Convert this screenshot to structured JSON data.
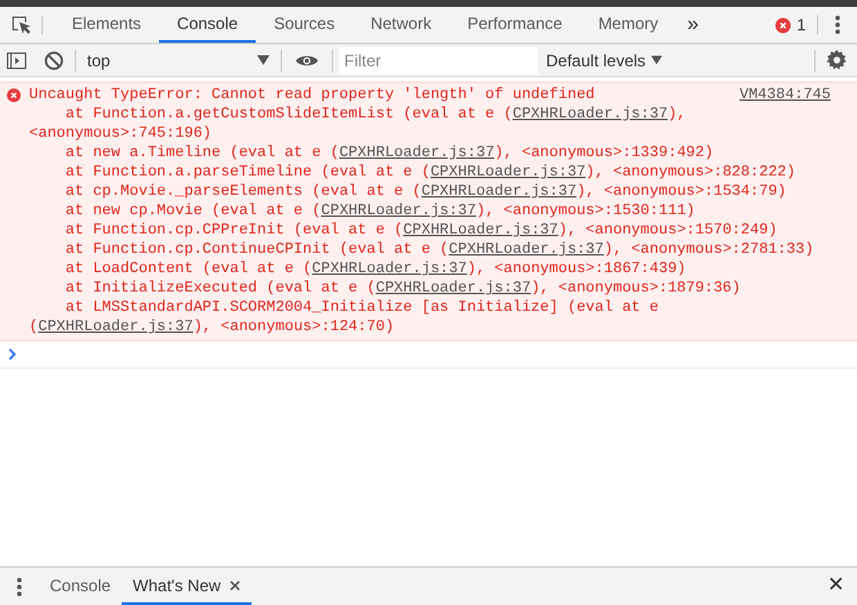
{
  "tabs": [
    {
      "label": "Elements",
      "selected": false
    },
    {
      "label": "Console",
      "selected": true
    },
    {
      "label": "Sources",
      "selected": false
    },
    {
      "label": "Network",
      "selected": false
    },
    {
      "label": "Performance",
      "selected": false
    },
    {
      "label": "Memory",
      "selected": false
    }
  ],
  "overflow": "»",
  "error_count": "1",
  "toolbar": {
    "context": "top",
    "filter_placeholder": "Filter",
    "levels": "Default levels"
  },
  "messages": [
    {
      "kind": "error",
      "text": "Uncaught TypeError: Cannot read property 'length' of undefined",
      "source": "VM4384:745",
      "stack": [
        {
          "prefix": "    at Function.a.getCustomSlideItemList (eval at e (",
          "link": "CPXHRLoader.js:37",
          "suffix": "), <anonymous>:745:196)"
        },
        {
          "prefix": "    at new a.Timeline (eval at e (",
          "link": "CPXHRLoader.js:37",
          "suffix": "), <anonymous>:1339:492)"
        },
        {
          "prefix": "    at Function.a.parseTimeline (eval at e (",
          "link": "CPXHRLoader.js:37",
          "suffix": "), <anonymous>:828:222)"
        },
        {
          "prefix": "    at cp.Movie._parseElements (eval at e (",
          "link": "CPXHRLoader.js:37",
          "suffix": "), <anonymous>:1534:79)"
        },
        {
          "prefix": "    at new cp.Movie (eval at e (",
          "link": "CPXHRLoader.js:37",
          "suffix": "), <anonymous>:1530:111)"
        },
        {
          "prefix": "    at Function.cp.CPPreInit (eval at e (",
          "link": "CPXHRLoader.js:37",
          "suffix": "), <anonymous>:1570:249)"
        },
        {
          "prefix": "    at Function.cp.ContinueCPInit (eval at e (",
          "link": "CPXHRLoader.js:37",
          "suffix": "), <anonymous>:2781:33)"
        },
        {
          "prefix": "    at LoadContent (eval at e (",
          "link": "CPXHRLoader.js:37",
          "suffix": "), <anonymous>:1867:439)"
        },
        {
          "prefix": "    at InitializeExecuted (eval at e (",
          "link": "CPXHRLoader.js:37",
          "suffix": "), <anonymous>:1879:36)"
        },
        {
          "prefix": "    at LMSStandardAPI.SCORM2004_Initialize [as Initialize] (eval at e (",
          "link": "CPXHRLoader.js:37",
          "suffix": "), <anonymous>:124:70)"
        }
      ]
    }
  ],
  "drawer_tabs": [
    {
      "label": "Console",
      "selected": false,
      "closable": false
    },
    {
      "label": "What's New",
      "selected": true,
      "closable": true
    }
  ],
  "drawer_close": "✕"
}
